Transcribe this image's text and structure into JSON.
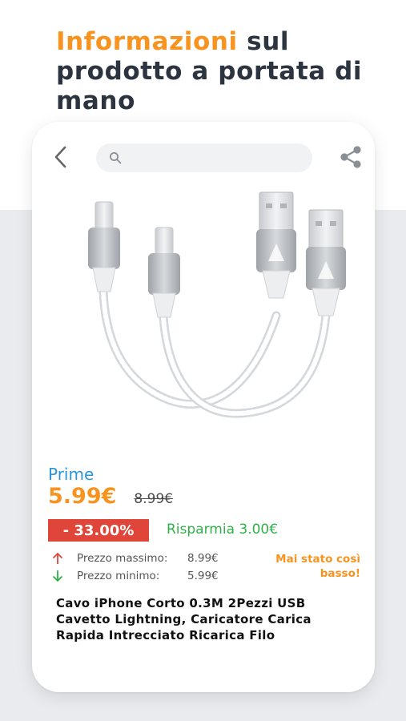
{
  "headline": {
    "accent": "Informazioni",
    "rest": "sul prodotto a portata di mano"
  },
  "nav": {
    "back_icon": "chevron-left-icon",
    "search_icon": "search-icon",
    "search_value": "",
    "share_icon": "share-icon"
  },
  "product": {
    "image_icon": "lightning-usb-cable-icon",
    "badge": "Prime",
    "price": "5.99€",
    "old_price": "8.99€",
    "discount": "- 33.00%",
    "savings": "Risparmia 3.00€",
    "max_label": "Prezzo massimo:",
    "max_value": "8.99€",
    "min_label": "Prezzo minimo:",
    "min_value": "5.99€",
    "note": "Mai stato così basso!",
    "title": "Cavo iPhone Corto 0.3M 2Pezzi USB Cavetto Lightning, Caricatore Carica Rapida Intrecciato Ricarica Filo"
  },
  "colors": {
    "accent": "#f7931e",
    "prime": "#2996dc",
    "discount_bg": "#e0453a",
    "savings": "#2fb14a",
    "up_arrow": "#e0453a",
    "down_arrow": "#2fb14a"
  }
}
